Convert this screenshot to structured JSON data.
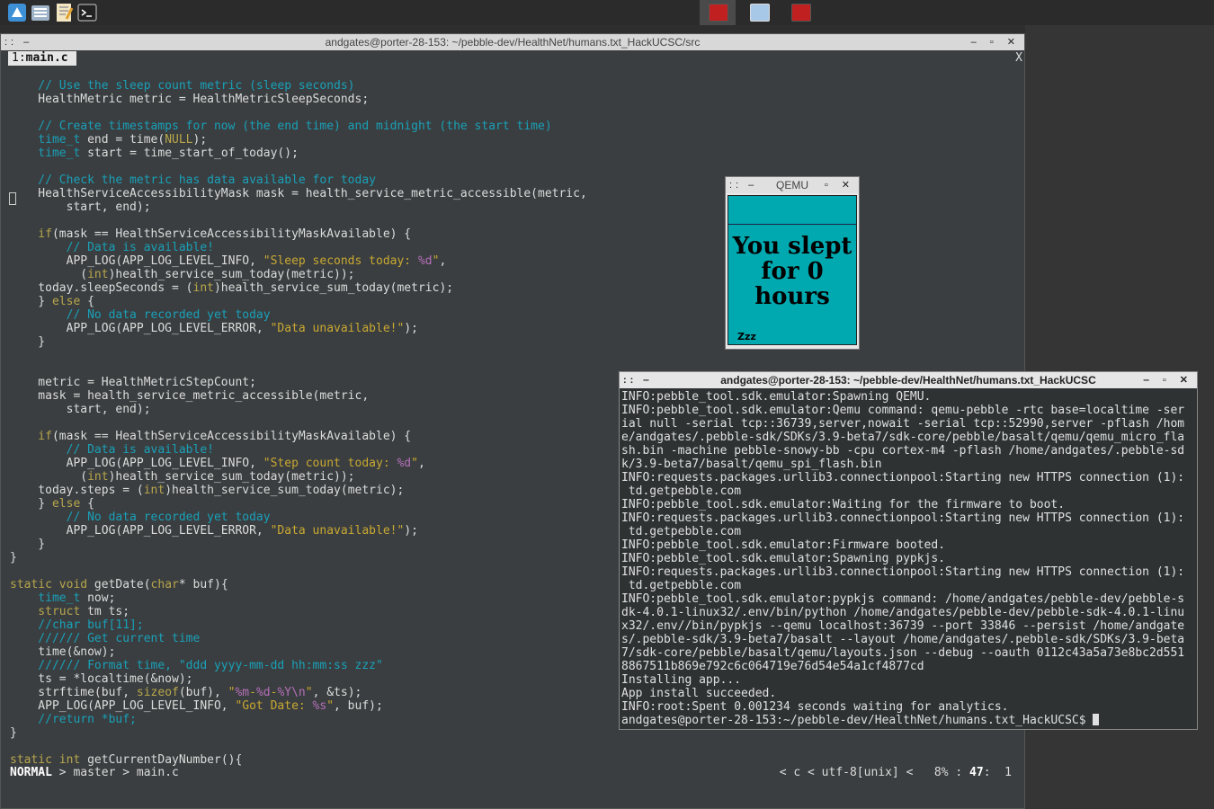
{
  "panel": {
    "launchers": [
      {
        "name": "app-menu-icon",
        "color": "#3d8fd6"
      },
      {
        "name": "file-manager-icon",
        "color": "#9fb4c8"
      },
      {
        "name": "text-editor-icon",
        "color": "#e0b050"
      },
      {
        "name": "terminal-icon",
        "color": "#222222"
      }
    ],
    "tasks": [
      {
        "name": "task-red-terminal",
        "color": "#c02020",
        "active": true
      },
      {
        "name": "task-window",
        "color": "#a8c8e8",
        "active": false
      },
      {
        "name": "task-red-terminal-2",
        "color": "#c02020",
        "active": false
      }
    ]
  },
  "editor": {
    "title": "andgates@porter-28-153: ~/pebble-dev/HealthNet/humans.txt_HackUCSC/src",
    "tab_number": "1:",
    "tab_name": "main.c",
    "tab_close": "X",
    "status": {
      "mode": "NORMAL",
      "branch": " > master > main.c",
      "right": "< c < utf-8[unix] <   8% : ",
      "line": "47",
      "col": ":  1"
    }
  },
  "qemu": {
    "title": "QEMU",
    "message_line1": "You slept",
    "message_line2": "for 0",
    "message_line3": "hours",
    "zzz": "Zzz"
  },
  "terminal": {
    "title": "andgates@porter-28-153: ~/pebble-dev/HealthNet/humans.txt_HackUCSC",
    "lines": [
      "INFO:pebble_tool.sdk.emulator:Spawning QEMU.",
      "INFO:pebble_tool.sdk.emulator:Qemu command: qemu-pebble -rtc base=localtime -ser",
      "ial null -serial tcp::36739,server,nowait -serial tcp::52990,server -pflash /hom",
      "e/andgates/.pebble-sdk/SDKs/3.9-beta7/sdk-core/pebble/basalt/qemu/qemu_micro_fla",
      "sh.bin -machine pebble-snowy-bb -cpu cortex-m4 -pflash /home/andgates/.pebble-sd",
      "k/3.9-beta7/basalt/qemu_spi_flash.bin",
      "INFO:requests.packages.urllib3.connectionpool:Starting new HTTPS connection (1):",
      " td.getpebble.com",
      "INFO:pebble_tool.sdk.emulator:Waiting for the firmware to boot.",
      "INFO:requests.packages.urllib3.connectionpool:Starting new HTTPS connection (1):",
      " td.getpebble.com",
      "INFO:pebble_tool.sdk.emulator:Firmware booted.",
      "INFO:pebble_tool.sdk.emulator:Spawning pypkjs.",
      "INFO:requests.packages.urllib3.connectionpool:Starting new HTTPS connection (1):",
      " td.getpebble.com",
      "INFO:pebble_tool.sdk.emulator:pypkjs command: /home/andgates/pebble-dev/pebble-s",
      "dk-4.0.1-linux32/.env/bin/python /home/andgates/pebble-dev/pebble-sdk-4.0.1-linu",
      "x32/.env//bin/pypkjs --qemu localhost:36739 --port 33846 --persist /home/andgate",
      "s/.pebble-sdk/3.9-beta7/basalt --layout /home/andgates/.pebble-sdk/SDKs/3.9-beta",
      "7/sdk-core/pebble/basalt/qemu/layouts.json --debug --oauth 0112c43a5a73e8bc2d551",
      "8867511b869e792c6c064719e76d54e54a1cf4877cd",
      "Installing app...",
      "App install succeeded.",
      "INFO:root:Spent 0.001234 seconds waiting for analytics."
    ],
    "prompt": "andgates@porter-28-153:~/pebble-dev/HealthNet/humans.txt_HackUCSC$ "
  },
  "code": [
    [
      [
        "c",
        "    // Use the sleep count metric (sleep seconds)"
      ]
    ],
    [
      [
        "n",
        "    HealthMetric metric = HealthMetricSleepSeconds;"
      ]
    ],
    [
      [
        "n",
        ""
      ]
    ],
    [
      [
        "c",
        "    // Create timestamps for now (the end time) and midnight (the start time)"
      ]
    ],
    [
      [
        "t",
        "    time_t"
      ],
      [
        "n",
        " end = time("
      ],
      [
        "k",
        "NULL"
      ],
      [
        "n",
        ");"
      ]
    ],
    [
      [
        "t",
        "    time_t"
      ],
      [
        "n",
        " start = time_start_of_today();"
      ]
    ],
    [
      [
        "n",
        ""
      ]
    ],
    [
      [
        "c",
        "    // Check the metric has data available for today"
      ]
    ],
    [
      [
        "n",
        "    HealthServiceAccessibilityMask mask = health_service_metric_accessible(metric,"
      ]
    ],
    [
      [
        "n",
        "        start, end);"
      ]
    ],
    [
      [
        "n",
        ""
      ]
    ],
    [
      [
        "k",
        "    if"
      ],
      [
        "n",
        "(mask == HealthServiceAccessibilityMaskAvailable) {"
      ]
    ],
    [
      [
        "c",
        "        // Data is available!"
      ]
    ],
    [
      [
        "n",
        "        APP_LOG(APP_LOG_LEVEL_INFO, "
      ],
      [
        "s",
        "\"Sleep seconds today: "
      ],
      [
        "p",
        "%d"
      ],
      [
        "s",
        "\""
      ],
      [
        "n",
        ","
      ]
    ],
    [
      [
        "n",
        "          ("
      ],
      [
        "k",
        "int"
      ],
      [
        "n",
        ")health_service_sum_today(metric));"
      ]
    ],
    [
      [
        "n",
        "    today.sleepSeconds = ("
      ],
      [
        "k",
        "int"
      ],
      [
        "n",
        ")health_service_sum_today(metric);"
      ]
    ],
    [
      [
        "n",
        "    } "
      ],
      [
        "k",
        "else"
      ],
      [
        "n",
        " {"
      ]
    ],
    [
      [
        "c",
        "        // No data recorded yet today"
      ]
    ],
    [
      [
        "n",
        "        APP_LOG(APP_LOG_LEVEL_ERROR, "
      ],
      [
        "s",
        "\"Data unavailable!\""
      ],
      [
        "n",
        ");"
      ]
    ],
    [
      [
        "n",
        "    }"
      ]
    ],
    [
      [
        "n",
        ""
      ]
    ],
    [
      [
        "n",
        ""
      ]
    ],
    [
      [
        "n",
        "    metric = HealthMetricStepCount;"
      ]
    ],
    [
      [
        "n",
        "    mask = health_service_metric_accessible(metric,"
      ]
    ],
    [
      [
        "n",
        "        start, end);"
      ]
    ],
    [
      [
        "n",
        ""
      ]
    ],
    [
      [
        "k",
        "    if"
      ],
      [
        "n",
        "(mask == HealthServiceAccessibilityMaskAvailable) {"
      ]
    ],
    [
      [
        "c",
        "        // Data is available!"
      ]
    ],
    [
      [
        "n",
        "        APP_LOG(APP_LOG_LEVEL_INFO, "
      ],
      [
        "s",
        "\"Step count today: "
      ],
      [
        "p",
        "%d"
      ],
      [
        "s",
        "\""
      ],
      [
        "n",
        ","
      ]
    ],
    [
      [
        "n",
        "          ("
      ],
      [
        "k",
        "int"
      ],
      [
        "n",
        ")health_service_sum_today(metric));"
      ]
    ],
    [
      [
        "n",
        "    today.steps = ("
      ],
      [
        "k",
        "int"
      ],
      [
        "n",
        ")health_service_sum_today(metric);"
      ]
    ],
    [
      [
        "n",
        "    } "
      ],
      [
        "k",
        "else"
      ],
      [
        "n",
        " {"
      ]
    ],
    [
      [
        "c",
        "        // No data recorded yet today"
      ]
    ],
    [
      [
        "n",
        "        APP_LOG(APP_LOG_LEVEL_ERROR, "
      ],
      [
        "s",
        "\"Data unavailable!\""
      ],
      [
        "n",
        ");"
      ]
    ],
    [
      [
        "n",
        "    }"
      ]
    ],
    [
      [
        "n",
        "}"
      ]
    ],
    [
      [
        "n",
        ""
      ]
    ],
    [
      [
        "k",
        "static void"
      ],
      [
        "n",
        " getDate("
      ],
      [
        "k",
        "char"
      ],
      [
        "n",
        "* buf){"
      ]
    ],
    [
      [
        "t",
        "    time_t"
      ],
      [
        "n",
        " now;"
      ]
    ],
    [
      [
        "k",
        "    struct"
      ],
      [
        "n",
        " tm ts;"
      ]
    ],
    [
      [
        "c",
        "    //char buf[11];"
      ]
    ],
    [
      [
        "c",
        "    ////// Get current time"
      ]
    ],
    [
      [
        "n",
        "    time(&now);"
      ]
    ],
    [
      [
        "c",
        "    ////// Format time, \"ddd yyyy-mm-dd hh:mm:ss zzz\""
      ]
    ],
    [
      [
        "n",
        "    ts = *localtime(&now);"
      ]
    ],
    [
      [
        "n",
        "    strftime(buf, "
      ],
      [
        "k",
        "sizeof"
      ],
      [
        "n",
        "(buf), "
      ],
      [
        "s",
        "\""
      ],
      [
        "p",
        "%m"
      ],
      [
        "s",
        "-"
      ],
      [
        "p",
        "%d"
      ],
      [
        "s",
        "-"
      ],
      [
        "p",
        "%Y\\n"
      ],
      [
        "s",
        "\""
      ],
      [
        "n",
        ", &ts);"
      ]
    ],
    [
      [
        "n",
        "    APP_LOG(APP_LOG_LEVEL_INFO, "
      ],
      [
        "s",
        "\"Got Date: "
      ],
      [
        "p",
        "%s"
      ],
      [
        "s",
        "\""
      ],
      [
        "n",
        ", buf);"
      ]
    ],
    [
      [
        "c",
        "    //return *buf;"
      ]
    ],
    [
      [
        "n",
        "}"
      ]
    ],
    [
      [
        "n",
        ""
      ]
    ],
    [
      [
        "k",
        "static int"
      ],
      [
        "n",
        " getCurrentDayNumber(){"
      ]
    ]
  ]
}
